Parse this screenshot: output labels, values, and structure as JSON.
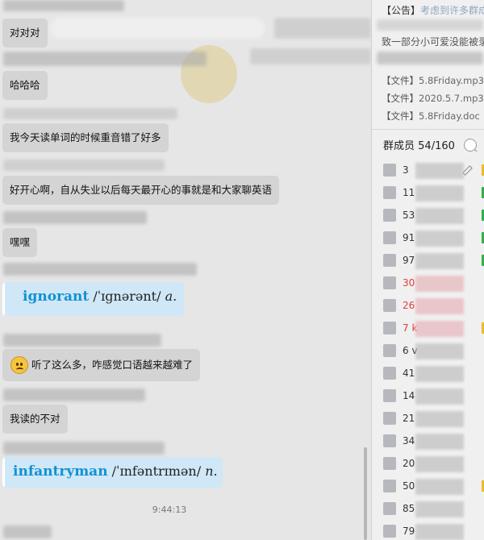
{
  "chat": {
    "messages": [
      {
        "text": "对对对"
      },
      {
        "text": "哈哈哈"
      },
      {
        "text": "我今天读单词的时候重音错了好多"
      },
      {
        "text": "好开心啊，自从失业以后每天最开心的事就是和大家聊英语"
      },
      {
        "text": "嘿嘿"
      },
      {
        "text": "听了这么多，咋感觉口语越来越难了",
        "emoji": "frowning-face"
      },
      {
        "text": "我读的不对"
      }
    ],
    "dict_cards": [
      {
        "word": "ignorant",
        "pron": "/ˈɪgnərənt/",
        "pos": "a."
      },
      {
        "word": "infantryman",
        "pron": "/ˈɪnfəntrɪmən/",
        "pos": "n."
      }
    ],
    "timestamp": "9:44:13"
  },
  "sidebar": {
    "notice": {
      "tag": "【公告】",
      "text": "考虑到许多群成"
    },
    "notice_line2": "致一部分小可爱没能被录",
    "files": [
      {
        "tag": "【文件】",
        "name": "5.8Friday.mp3"
      },
      {
        "tag": "【文件】",
        "name": "2020.5.7.mp3"
      },
      {
        "tag": "【文件】",
        "name": "5.8Friday.doc"
      }
    ],
    "members_title": "群成员",
    "members_count": "54/160",
    "members": [
      {
        "prefix": "3"
      },
      {
        "prefix": "11"
      },
      {
        "prefix": "53"
      },
      {
        "prefix": "91"
      },
      {
        "prefix": "97"
      },
      {
        "prefix": "30",
        "color": "#e23b3b"
      },
      {
        "prefix": "26",
        "color": "#e23b3b"
      },
      {
        "prefix": "7 k",
        "color": "#e23b3b"
      },
      {
        "prefix": "6 v"
      },
      {
        "prefix": "41"
      },
      {
        "prefix": "14"
      },
      {
        "prefix": "21"
      },
      {
        "prefix": "34"
      },
      {
        "prefix": "20"
      },
      {
        "prefix": "50"
      },
      {
        "prefix": "85"
      },
      {
        "prefix": "79"
      }
    ]
  }
}
